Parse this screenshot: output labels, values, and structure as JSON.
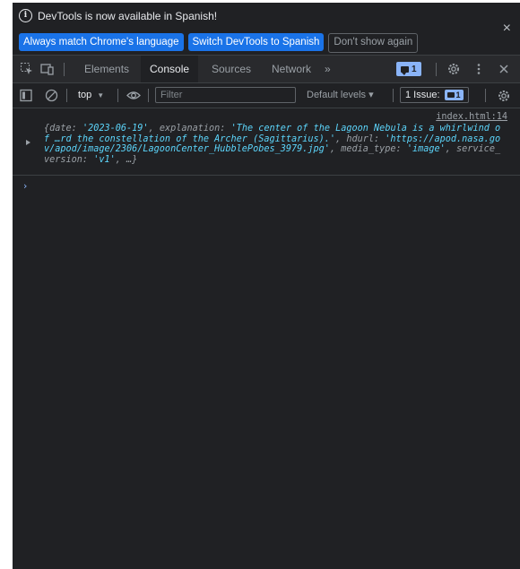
{
  "infobar": {
    "message": "DevTools is now available in Spanish!",
    "btn_match": "Always match Chrome's language",
    "btn_switch": "Switch DevTools to Spanish",
    "btn_dismiss": "Don't show again",
    "close_glyph": "×"
  },
  "tabs": {
    "elements": "Elements",
    "console": "Console",
    "sources": "Sources",
    "network": "Network",
    "more": "»",
    "message_count": "1"
  },
  "console_toolbar": {
    "context": "top",
    "filter_placeholder": "Filter",
    "levels": "Default levels ▾",
    "issues_label": "1 Issue:",
    "issues_count": "1"
  },
  "log": {
    "source": "index.html:14",
    "open": "{",
    "k_date": "date: ",
    "v_date": "'2023-06-19'",
    "k_explanation": ", explanation: ",
    "v_explanation": "'The center of the Lagoon Nebula is a whirlwind of …rd the constellation of the Archer (Sagittarius).'",
    "k_hdurl": ", hdurl: ",
    "v_hdurl": "'https://apod.nasa.gov/apod/image/2306/LagoonCenter_HubblePobes_3979.jpg'",
    "k_media": ", media_type: ",
    "v_media": "'image'",
    "k_service": ", service_version: ",
    "v_service": "'v1'",
    "close": ", …}"
  },
  "prompt": "›",
  "colors": {
    "background": "#202124",
    "accent": "#1a73e8",
    "string": "#5cd5fb",
    "badge": "#8ab4f8"
  }
}
